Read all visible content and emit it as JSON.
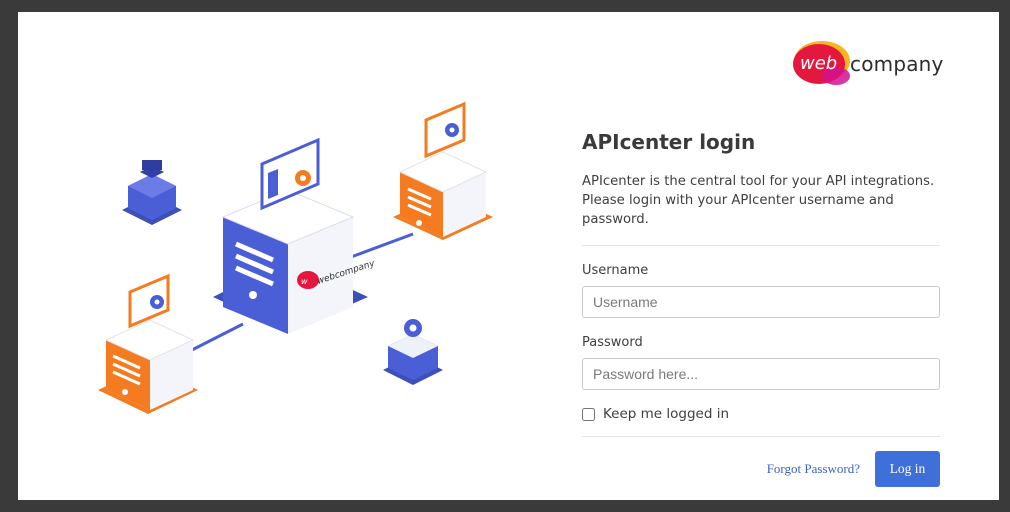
{
  "brand": {
    "logo_web": "web",
    "logo_company": "company",
    "illustration_logo": "webcompany"
  },
  "login": {
    "title": "APIcenter login",
    "intro": "APIcenter is the central tool for your API integrations. Please login with your APIcenter username and password.",
    "username_label": "Username",
    "username_placeholder": "Username",
    "username_value": "",
    "password_label": "Password",
    "password_placeholder": "Password here...",
    "password_value": "",
    "keep_logged_in_label": "Keep me logged in",
    "keep_logged_in_checked": false,
    "forgot_password": "Forgot Password?",
    "submit_label": "Log in"
  },
  "colors": {
    "primary": "#3f6fd8",
    "link": "#3a63c4",
    "illustration_blue": "#4a5fd6",
    "illustration_orange": "#f47b20",
    "logo_red": "#e4173f"
  }
}
